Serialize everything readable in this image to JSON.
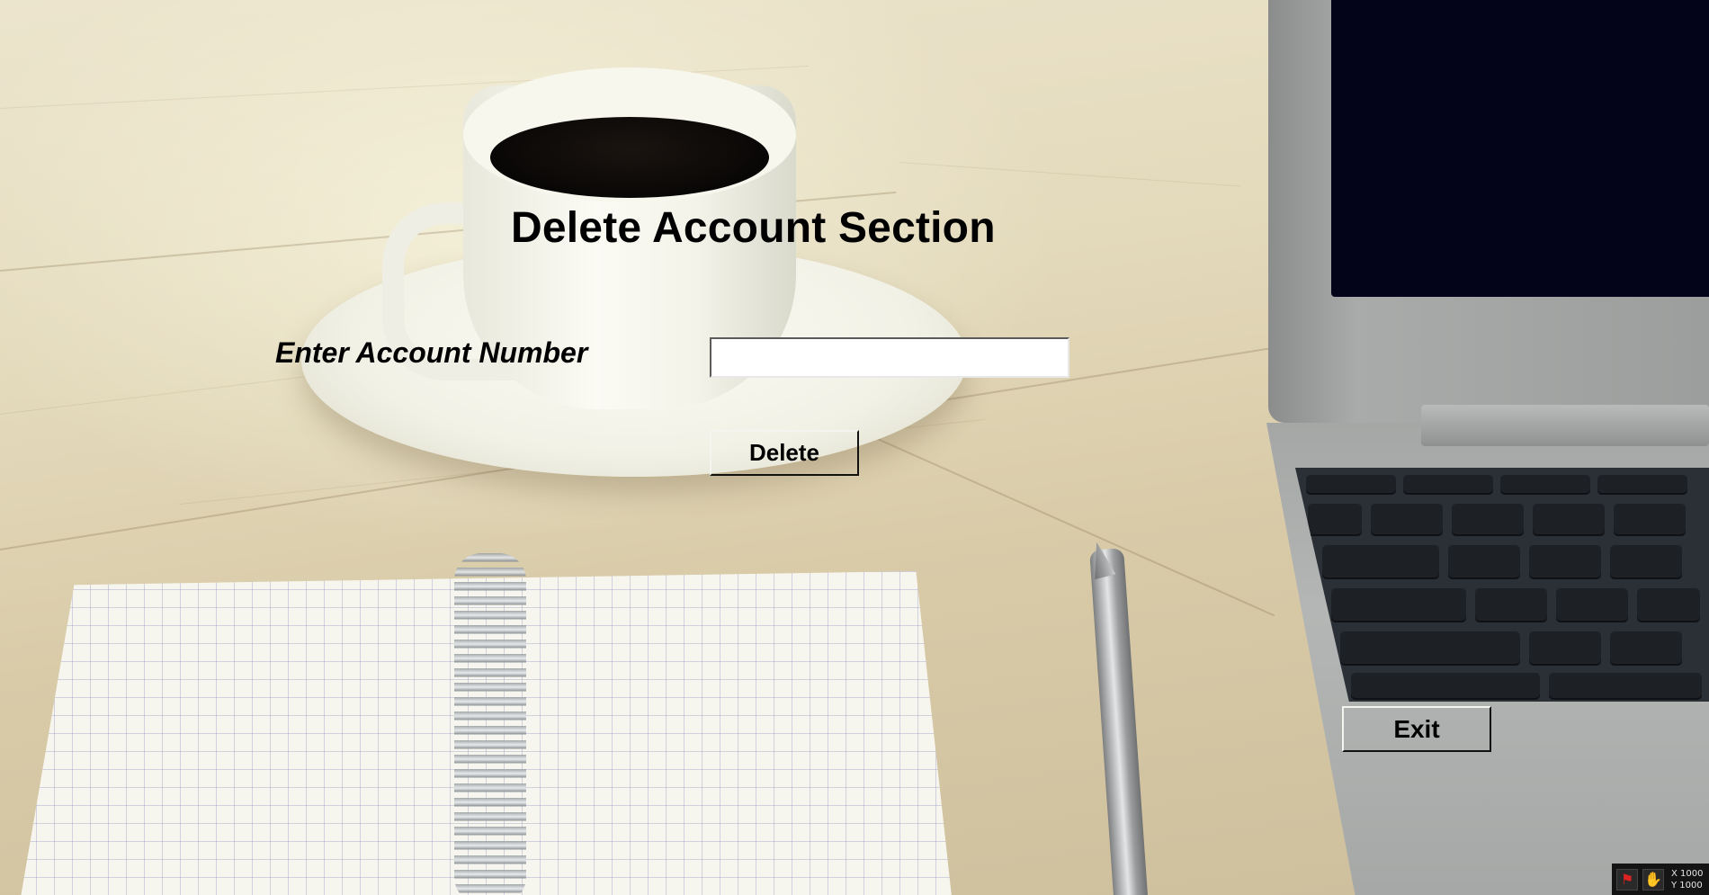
{
  "window": {
    "title": "Delete Account Section"
  },
  "form": {
    "account_label": "Enter Account Number",
    "account_value": ""
  },
  "buttons": {
    "delete_label": "Delete",
    "exit_label": "Exit"
  },
  "tray": {
    "icons": [
      "red-figure-icon",
      "red-hand-icon"
    ],
    "x_readout": "X 1000",
    "y_readout": "Y 1000"
  },
  "colors": {
    "text": "#000000",
    "input_background": "#ffffff",
    "laptop_screen": "#03031a"
  }
}
